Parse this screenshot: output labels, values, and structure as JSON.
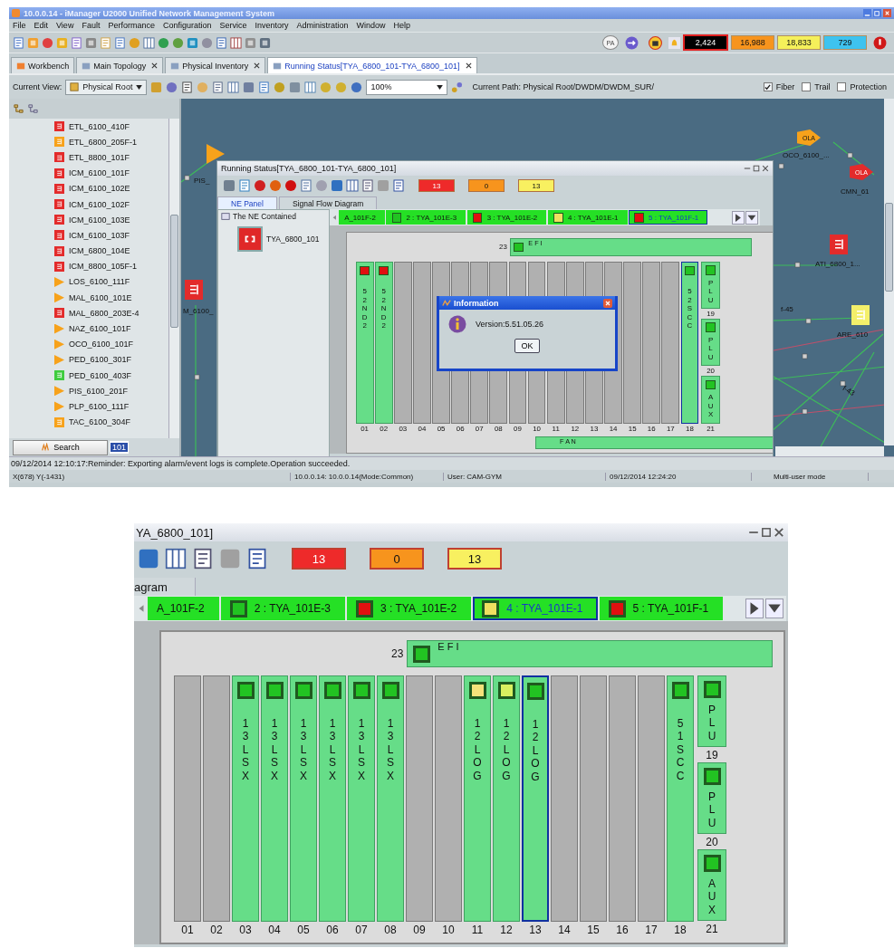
{
  "window": {
    "title": "10.0.0.14 - iManager U2000 Unified Network Management System"
  },
  "menu": [
    "File",
    "Edit",
    "View",
    "Fault",
    "Performance",
    "Configuration",
    "Service",
    "Inventory",
    "Administration",
    "Window",
    "Help"
  ],
  "toolbar": {
    "pa_button": "PA",
    "alarm_counts": [
      {
        "text": "2,424",
        "color": "#000000"
      },
      {
        "text": "16,988",
        "color": "#f7941d"
      },
      {
        "text": "18,833",
        "color": "#f5f05a"
      },
      {
        "text": "729",
        "color": "#3ec3ef"
      }
    ]
  },
  "tabs": [
    {
      "label": "Workbench",
      "closable": false,
      "selected": false
    },
    {
      "label": "Main Topology",
      "closable": true,
      "selected": false
    },
    {
      "label": "Physical Inventory",
      "closable": true,
      "selected": false
    },
    {
      "label": "Running Status[TYA_6800_101-TYA_6800_101]",
      "closable": true,
      "selected": true
    }
  ],
  "view_bar": {
    "label": "Current View:",
    "view": "Physical Root",
    "zoom": "100%",
    "path": "Current Path: Physical Root/DWDM/DWDM_SUR/",
    "checkboxes": [
      {
        "label": "Fiber",
        "checked": true
      },
      {
        "label": "Trail",
        "checked": false
      },
      {
        "label": "Protection",
        "checked": false
      }
    ]
  },
  "tree": {
    "items": [
      {
        "label": "ETL_6100_410F",
        "kind": "terminal",
        "color": "#e32b2b"
      },
      {
        "label": "ETL_6800_205F-1",
        "kind": "terminal",
        "color": "#f7a21b"
      },
      {
        "label": "ETL_8800_101F",
        "kind": "terminal",
        "color": "#e32b2b"
      },
      {
        "label": "ICM_6100_101F",
        "kind": "terminal",
        "color": "#e32b2b"
      },
      {
        "label": "ICM_6100_102E",
        "kind": "terminal",
        "color": "#e32b2b"
      },
      {
        "label": "ICM_6100_102F",
        "kind": "terminal",
        "color": "#e32b2b"
      },
      {
        "label": "ICM_6100_103E",
        "kind": "terminal",
        "color": "#e32b2b"
      },
      {
        "label": "ICM_6100_103F",
        "kind": "terminal",
        "color": "#e32b2b"
      },
      {
        "label": "ICM_6800_104E",
        "kind": "terminal",
        "color": "#e32b2b"
      },
      {
        "label": "ICM_8800_105F-1",
        "kind": "terminal",
        "color": "#e32b2b"
      },
      {
        "label": "LOS_6100_111F",
        "kind": "amplifier",
        "color": "#f7a21b"
      },
      {
        "label": "MAL_6100_101E",
        "kind": "amplifier",
        "color": "#f7a21b"
      },
      {
        "label": "MAL_6800_203E-4",
        "kind": "terminal",
        "color": "#e32b2b"
      },
      {
        "label": "NAZ_6100_101F",
        "kind": "amplifier",
        "color": "#f7a21b"
      },
      {
        "label": "OCO_6100_101F",
        "kind": "amplifier",
        "color": "#f7a21b"
      },
      {
        "label": "PED_6100_301F",
        "kind": "amplifier",
        "color": "#f7a21b"
      },
      {
        "label": "PED_6100_403F",
        "kind": "terminal",
        "color": "#3fcc3f"
      },
      {
        "label": "PIS_6100_201F",
        "kind": "amplifier",
        "color": "#f7a21b"
      },
      {
        "label": "PLP_6100_111F",
        "kind": "amplifier",
        "color": "#f7a21b"
      },
      {
        "label": "TAC_6100_304F",
        "kind": "terminal",
        "color": "#f7a21b"
      }
    ],
    "search_button": "Search",
    "search_value": "101"
  },
  "topology": {
    "nodes": [
      {
        "label": "PIS_",
        "kind": "amplifier",
        "color": "#f7a21b"
      },
      {
        "label": "M_6100_",
        "kind": "terminal",
        "color": "#e32b2b"
      },
      {
        "label": "OCO_6100_...",
        "kind": "ola",
        "color": "#f7a21b",
        "icon_text": "OLA"
      },
      {
        "label": "CMN_61",
        "kind": "ola",
        "color": "#e32b2b",
        "icon_text": "OLA"
      },
      {
        "label": "ATI_6800_1...",
        "kind": "terminal",
        "color": "#e32b2b"
      },
      {
        "label": "ARE_610",
        "kind": "terminal",
        "color": "#f3ef6a"
      }
    ],
    "link_labels": [
      "f-45",
      "f-43"
    ]
  },
  "running_status": {
    "title": "Running Status[TYA_6800_101-TYA_6800_101]",
    "alarm_counts": [
      {
        "text": "13",
        "color": "#ee2a2a"
      },
      {
        "text": "0",
        "color": "#f7941d"
      },
      {
        "text": "13",
        "color": "#f8f060"
      }
    ],
    "tabs": [
      {
        "label": "NE Panel",
        "selected": true
      },
      {
        "label": "Signal Flow Diagram",
        "selected": false
      }
    ],
    "ne_tree": {
      "label": "The NE Contained",
      "children": [
        {
          "label": "TYA_6800_101"
        }
      ]
    },
    "ne_panel": {
      "board_tabs": [
        {
          "label": "A_101F-2",
          "selected": false
        },
        {
          "label": "2 : TYA_101E-3",
          "color": "#22c322",
          "selected": false
        },
        {
          "label": "3 : TYA_101E-2",
          "color": "#e01010",
          "selected": false
        },
        {
          "label": "4 : TYA_101E-1",
          "color": "#f0e060",
          "selected": false
        },
        {
          "label": "5 : TYA_101F-1",
          "color": "#e01010",
          "selected": true
        }
      ],
      "efi": {
        "number": "23",
        "label": "E F I",
        "color": "#22c322"
      },
      "slots": [
        {
          "number": "01",
          "board": "52ND2",
          "color": "#e01010",
          "selected": false
        },
        {
          "number": "02",
          "board": "52ND2",
          "color": "#e01010",
          "selected": false
        },
        {
          "number": "03",
          "selected": false
        },
        {
          "number": "04",
          "selected": false
        },
        {
          "number": "05",
          "selected": false
        },
        {
          "number": "06",
          "selected": false
        },
        {
          "number": "07",
          "selected": false
        },
        {
          "number": "08",
          "selected": false
        },
        {
          "number": "09",
          "selected": false
        },
        {
          "number": "10",
          "selected": false
        },
        {
          "number": "11",
          "selected": false
        },
        {
          "number": "12",
          "selected": false
        },
        {
          "number": "13",
          "selected": false
        },
        {
          "number": "14",
          "selected": false
        },
        {
          "number": "15",
          "selected": false
        },
        {
          "number": "16",
          "selected": false
        },
        {
          "number": "17",
          "selected": false
        },
        {
          "number": "18",
          "board": "52SCC",
          "color": "#22c322",
          "selected": true
        }
      ],
      "side_slots": [
        {
          "number": "19",
          "board": "PLU",
          "color": "#22c322",
          "selected": false
        },
        {
          "number": "20",
          "board": "PLU",
          "color": "#22c322",
          "selected": false
        },
        {
          "number": "21",
          "board": "AUX",
          "color": "#22c322",
          "selected": false
        }
      ],
      "fan": "F A N"
    },
    "dialog": {
      "title": "Information",
      "message": "Version:5.51.05.26",
      "button": "OK"
    }
  },
  "status_message": "09/12/2014 12:10:17:Reminder: Exporting alarm/event logs is complete.Operation succeeded.",
  "status_bar": [
    "X(678) Y(-1431)",
    "10.0.0.14: 10.0.0.14(Mode:Common)",
    "User: CAM-GYM",
    "09/12/2014 12:24:20",
    "Multi-user mode"
  ],
  "zoomed_view": {
    "title": "YA_6800_101]",
    "alarm_counts": [
      {
        "text": "13",
        "color": "#ee2a2a"
      },
      {
        "text": "0",
        "color": "#f7941d"
      },
      {
        "text": "13",
        "color": "#f8f060"
      }
    ],
    "tab": "agram",
    "ne_panel": {
      "board_tabs": [
        {
          "label": "A_101F-2",
          "selected": false
        },
        {
          "label": "2 : TYA_101E-3",
          "color": "#22c322",
          "selected": false
        },
        {
          "label": "3 : TYA_101E-2",
          "color": "#e01010",
          "selected": false
        },
        {
          "label": "4 : TYA_101E-1",
          "color": "#f0e060",
          "selected": true
        },
        {
          "label": "5 : TYA_101F-1",
          "color": "#e01010",
          "selected": false
        }
      ],
      "efi": {
        "number": "23",
        "label": "E F I",
        "color": "#22c322"
      },
      "slots": [
        {
          "number": "01",
          "selected": false
        },
        {
          "number": "02",
          "selected": false
        },
        {
          "number": "03",
          "board": "13LSX",
          "color": "#22c322",
          "selected": false
        },
        {
          "number": "04",
          "board": "13LSX",
          "color": "#22c322",
          "selected": false
        },
        {
          "number": "05",
          "board": "13LSX",
          "color": "#22c322",
          "selected": false
        },
        {
          "number": "06",
          "board": "13LSX",
          "color": "#22c322",
          "selected": false
        },
        {
          "number": "07",
          "board": "13LSX",
          "color": "#22c322",
          "selected": false
        },
        {
          "number": "08",
          "board": "13LSX",
          "color": "#22c322",
          "selected": false
        },
        {
          "number": "09",
          "selected": false
        },
        {
          "number": "10",
          "selected": false
        },
        {
          "number": "11",
          "board": "12LOG",
          "color": "#f5e27a",
          "selected": false
        },
        {
          "number": "12",
          "board": "12LOG",
          "color": "#d8f060",
          "selected": false
        },
        {
          "number": "13",
          "board": "12LOG",
          "color": "#22c322",
          "selected": true
        },
        {
          "number": "14",
          "selected": false
        },
        {
          "number": "15",
          "selected": false
        },
        {
          "number": "16",
          "selected": false
        },
        {
          "number": "17",
          "selected": false
        },
        {
          "number": "18",
          "board": "51SCC",
          "color": "#22c322",
          "selected": false
        }
      ],
      "side_slots": [
        {
          "number": "19",
          "board": "PLU",
          "color": "#22c322",
          "selected": false
        },
        {
          "number": "20",
          "board": "PLU",
          "color": "#22c322",
          "selected": false
        },
        {
          "number": "21",
          "board": "AUX",
          "color": "#22c322",
          "selected": false
        }
      ]
    }
  }
}
